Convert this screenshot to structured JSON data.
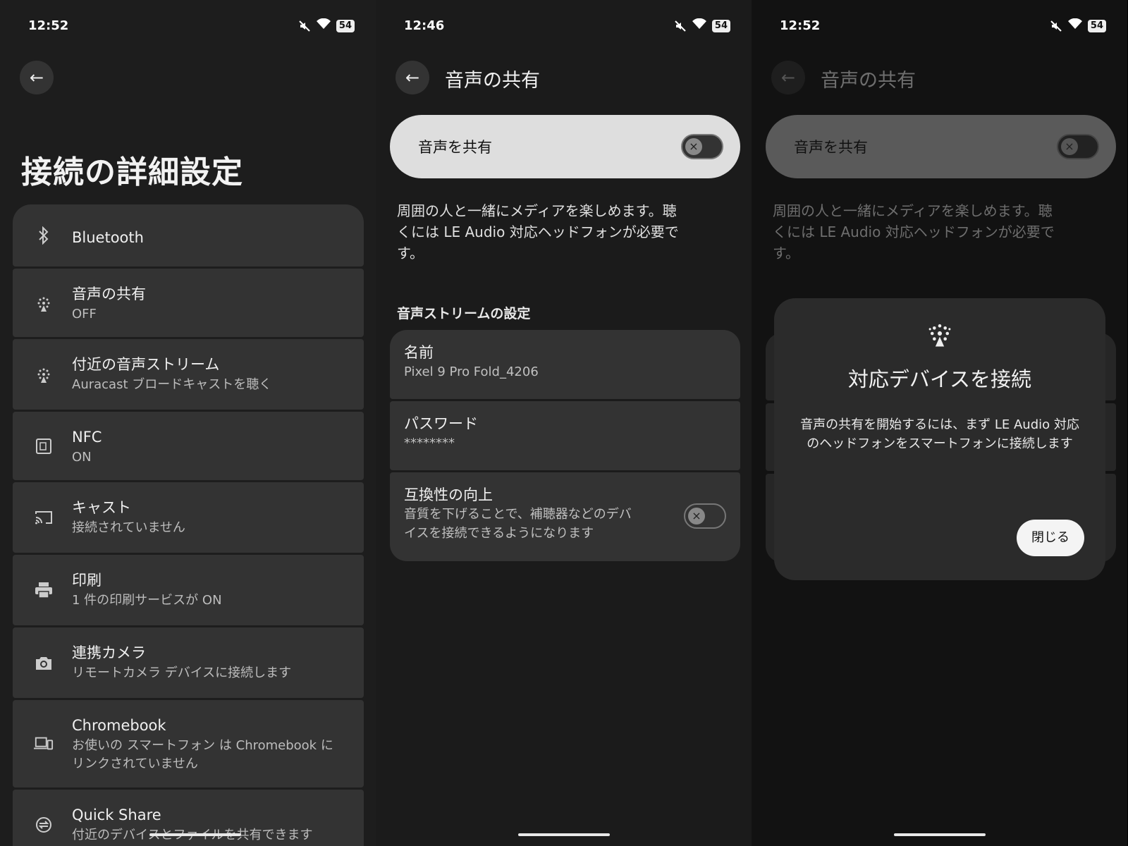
{
  "screen1": {
    "status": {
      "time": "12:52",
      "battery": "54"
    },
    "title": "接続の詳細設定",
    "items": [
      {
        "icon": "bluetooth-icon",
        "title": "Bluetooth",
        "subtitle": ""
      },
      {
        "icon": "audio-sharing-icon",
        "title": "音声の共有",
        "subtitle": "OFF"
      },
      {
        "icon": "audio-stream-icon",
        "title": "付近の音声ストリーム",
        "subtitle": "Auracast ブロードキャストを聴く"
      },
      {
        "icon": "nfc-icon",
        "title": "NFC",
        "subtitle": "ON"
      },
      {
        "icon": "cast-icon",
        "title": "キャスト",
        "subtitle": "接続されていません"
      },
      {
        "icon": "print-icon",
        "title": "印刷",
        "subtitle": "1 件の印刷サービスが ON"
      },
      {
        "icon": "camera-icon",
        "title": "連携カメラ",
        "subtitle": "リモートカメラ デバイスに接続します"
      },
      {
        "icon": "laptop-icon",
        "title": "Chromebook",
        "subtitle": "お使いの スマートフォン は Chromebook にリンクされていません"
      },
      {
        "icon": "quick-share-icon",
        "title": "Quick Share",
        "subtitle": "付近のデバイスとファイルを共有できます"
      }
    ]
  },
  "screen2": {
    "status": {
      "time": "12:46",
      "battery": "54"
    },
    "title": "音声の共有",
    "toggle_label": "音声を共有",
    "description": "周囲の人と一緒にメディアを楽しめます。聴くには LE Audio 対応ヘッドフォンが必要です。",
    "section_header": "音声ストリームの設定",
    "cards": [
      {
        "title": "名前",
        "subtitle": "Pixel 9 Pro Fold_4206"
      },
      {
        "title": "パスワード",
        "subtitle": "********"
      },
      {
        "title": "互換性の向上",
        "subtitle": "音質を下げることで、補聴器などのデバイスを接続できるようになります"
      }
    ]
  },
  "screen3": {
    "status": {
      "time": "12:52",
      "battery": "54"
    },
    "title": "音声の共有",
    "toggle_label": "音声を共有",
    "description": "周囲の人と一緒にメディアを楽しめます。聴くには LE Audio 対応ヘッドフォンが必要です。",
    "dialog": {
      "title": "対応デバイスを接続",
      "text": "音声の共有を開始するには、まず LE Audio 対応のヘッドフォンをスマートフォンに接続します",
      "button": "閉じる"
    }
  }
}
